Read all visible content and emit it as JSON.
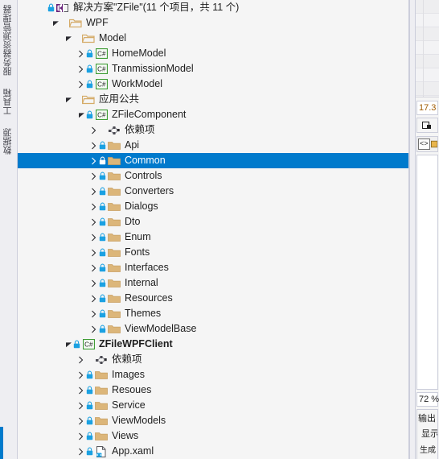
{
  "left_tabs": [
    {
      "label": "服务器资源管理器",
      "name": "tab-server-explorer"
    },
    {
      "label": "工具箱",
      "name": "tab-toolbox"
    },
    {
      "label": "数据源",
      "name": "tab-data-sources"
    }
  ],
  "solution_explorer": {
    "title": "解决方案\"ZFile\"(11 个项目，共 11 个)",
    "rows": [
      {
        "indent": 0,
        "expander": "none",
        "lock": true,
        "icon": "solution-icon",
        "label": "解决方案\"ZFile\"(11 个项目，共 11 个)",
        "bold": false,
        "selected": false
      },
      {
        "indent": 1,
        "expander": "open",
        "lock": false,
        "icon": "folder-open-icon",
        "label": "WPF",
        "bold": false,
        "selected": false
      },
      {
        "indent": 2,
        "expander": "open",
        "lock": false,
        "icon": "folder-open-icon",
        "label": "Model",
        "bold": false,
        "selected": false
      },
      {
        "indent": 3,
        "expander": "closed",
        "lock": true,
        "icon": "csharp-icon",
        "label": "HomeModel",
        "bold": false,
        "selected": false
      },
      {
        "indent": 3,
        "expander": "closed",
        "lock": true,
        "icon": "csharp-icon",
        "label": "TranmissionModel",
        "bold": false,
        "selected": false
      },
      {
        "indent": 3,
        "expander": "closed",
        "lock": true,
        "icon": "csharp-icon",
        "label": "WorkModel",
        "bold": false,
        "selected": false
      },
      {
        "indent": 2,
        "expander": "open",
        "lock": false,
        "icon": "folder-open-icon",
        "label": "应用公共",
        "bold": false,
        "selected": false
      },
      {
        "indent": 3,
        "expander": "open",
        "lock": true,
        "icon": "csharp-icon",
        "label": "ZFileComponent",
        "bold": false,
        "selected": false
      },
      {
        "indent": 4,
        "expander": "closed",
        "lock": false,
        "icon": "dependencies-icon",
        "label": "依赖项",
        "bold": false,
        "selected": false
      },
      {
        "indent": 4,
        "expander": "closed",
        "lock": true,
        "icon": "folder-icon",
        "label": "Api",
        "bold": false,
        "selected": false
      },
      {
        "indent": 4,
        "expander": "closed",
        "lock": true,
        "icon": "folder-icon",
        "label": "Common",
        "bold": false,
        "selected": true
      },
      {
        "indent": 4,
        "expander": "closed",
        "lock": true,
        "icon": "folder-icon",
        "label": "Controls",
        "bold": false,
        "selected": false
      },
      {
        "indent": 4,
        "expander": "closed",
        "lock": true,
        "icon": "folder-icon",
        "label": "Converters",
        "bold": false,
        "selected": false
      },
      {
        "indent": 4,
        "expander": "closed",
        "lock": true,
        "icon": "folder-icon",
        "label": "Dialogs",
        "bold": false,
        "selected": false
      },
      {
        "indent": 4,
        "expander": "closed",
        "lock": true,
        "icon": "folder-icon",
        "label": "Dto",
        "bold": false,
        "selected": false
      },
      {
        "indent": 4,
        "expander": "closed",
        "lock": true,
        "icon": "folder-icon",
        "label": "Enum",
        "bold": false,
        "selected": false
      },
      {
        "indent": 4,
        "expander": "closed",
        "lock": true,
        "icon": "folder-icon",
        "label": "Fonts",
        "bold": false,
        "selected": false
      },
      {
        "indent": 4,
        "expander": "closed",
        "lock": true,
        "icon": "folder-icon",
        "label": "Interfaces",
        "bold": false,
        "selected": false
      },
      {
        "indent": 4,
        "expander": "closed",
        "lock": true,
        "icon": "folder-icon",
        "label": "Internal",
        "bold": false,
        "selected": false
      },
      {
        "indent": 4,
        "expander": "closed",
        "lock": true,
        "icon": "folder-icon",
        "label": "Resources",
        "bold": false,
        "selected": false
      },
      {
        "indent": 4,
        "expander": "closed",
        "lock": true,
        "icon": "folder-icon",
        "label": "Themes",
        "bold": false,
        "selected": false
      },
      {
        "indent": 4,
        "expander": "closed",
        "lock": true,
        "icon": "folder-icon",
        "label": "ViewModelBase",
        "bold": false,
        "selected": false
      },
      {
        "indent": 2,
        "expander": "open",
        "lock": true,
        "icon": "csharp-icon",
        "label": "ZFileWPFClient",
        "bold": true,
        "selected": false
      },
      {
        "indent": 3,
        "expander": "closed",
        "lock": false,
        "icon": "dependencies-icon",
        "label": "依赖项",
        "bold": false,
        "selected": false
      },
      {
        "indent": 3,
        "expander": "closed",
        "lock": true,
        "icon": "folder-icon",
        "label": "Images",
        "bold": false,
        "selected": false
      },
      {
        "indent": 3,
        "expander": "closed",
        "lock": true,
        "icon": "folder-icon",
        "label": "Resoues",
        "bold": false,
        "selected": false
      },
      {
        "indent": 3,
        "expander": "closed",
        "lock": true,
        "icon": "folder-icon",
        "label": "Service",
        "bold": false,
        "selected": false
      },
      {
        "indent": 3,
        "expander": "closed",
        "lock": true,
        "icon": "folder-icon",
        "label": "ViewModels",
        "bold": false,
        "selected": false
      },
      {
        "indent": 3,
        "expander": "closed",
        "lock": true,
        "icon": "folder-icon",
        "label": "Views",
        "bold": false,
        "selected": false
      },
      {
        "indent": 3,
        "expander": "closed",
        "lock": true,
        "icon": "xaml-file-icon",
        "label": "App.xaml",
        "bold": false,
        "selected": false
      }
    ]
  },
  "right_panel": {
    "zoom_value": "17.3",
    "zoom_percent": "72 %",
    "code_button_label": "<>",
    "output_title": "输出",
    "output_row1": "显示",
    "output_row2": "生成"
  },
  "colors": {
    "accent": "#007acc",
    "folder": "#dcb67a",
    "csharp_green": "#3f9c35",
    "lock_blue": "#1ba1e2",
    "zoom_text": "#a05a00"
  }
}
